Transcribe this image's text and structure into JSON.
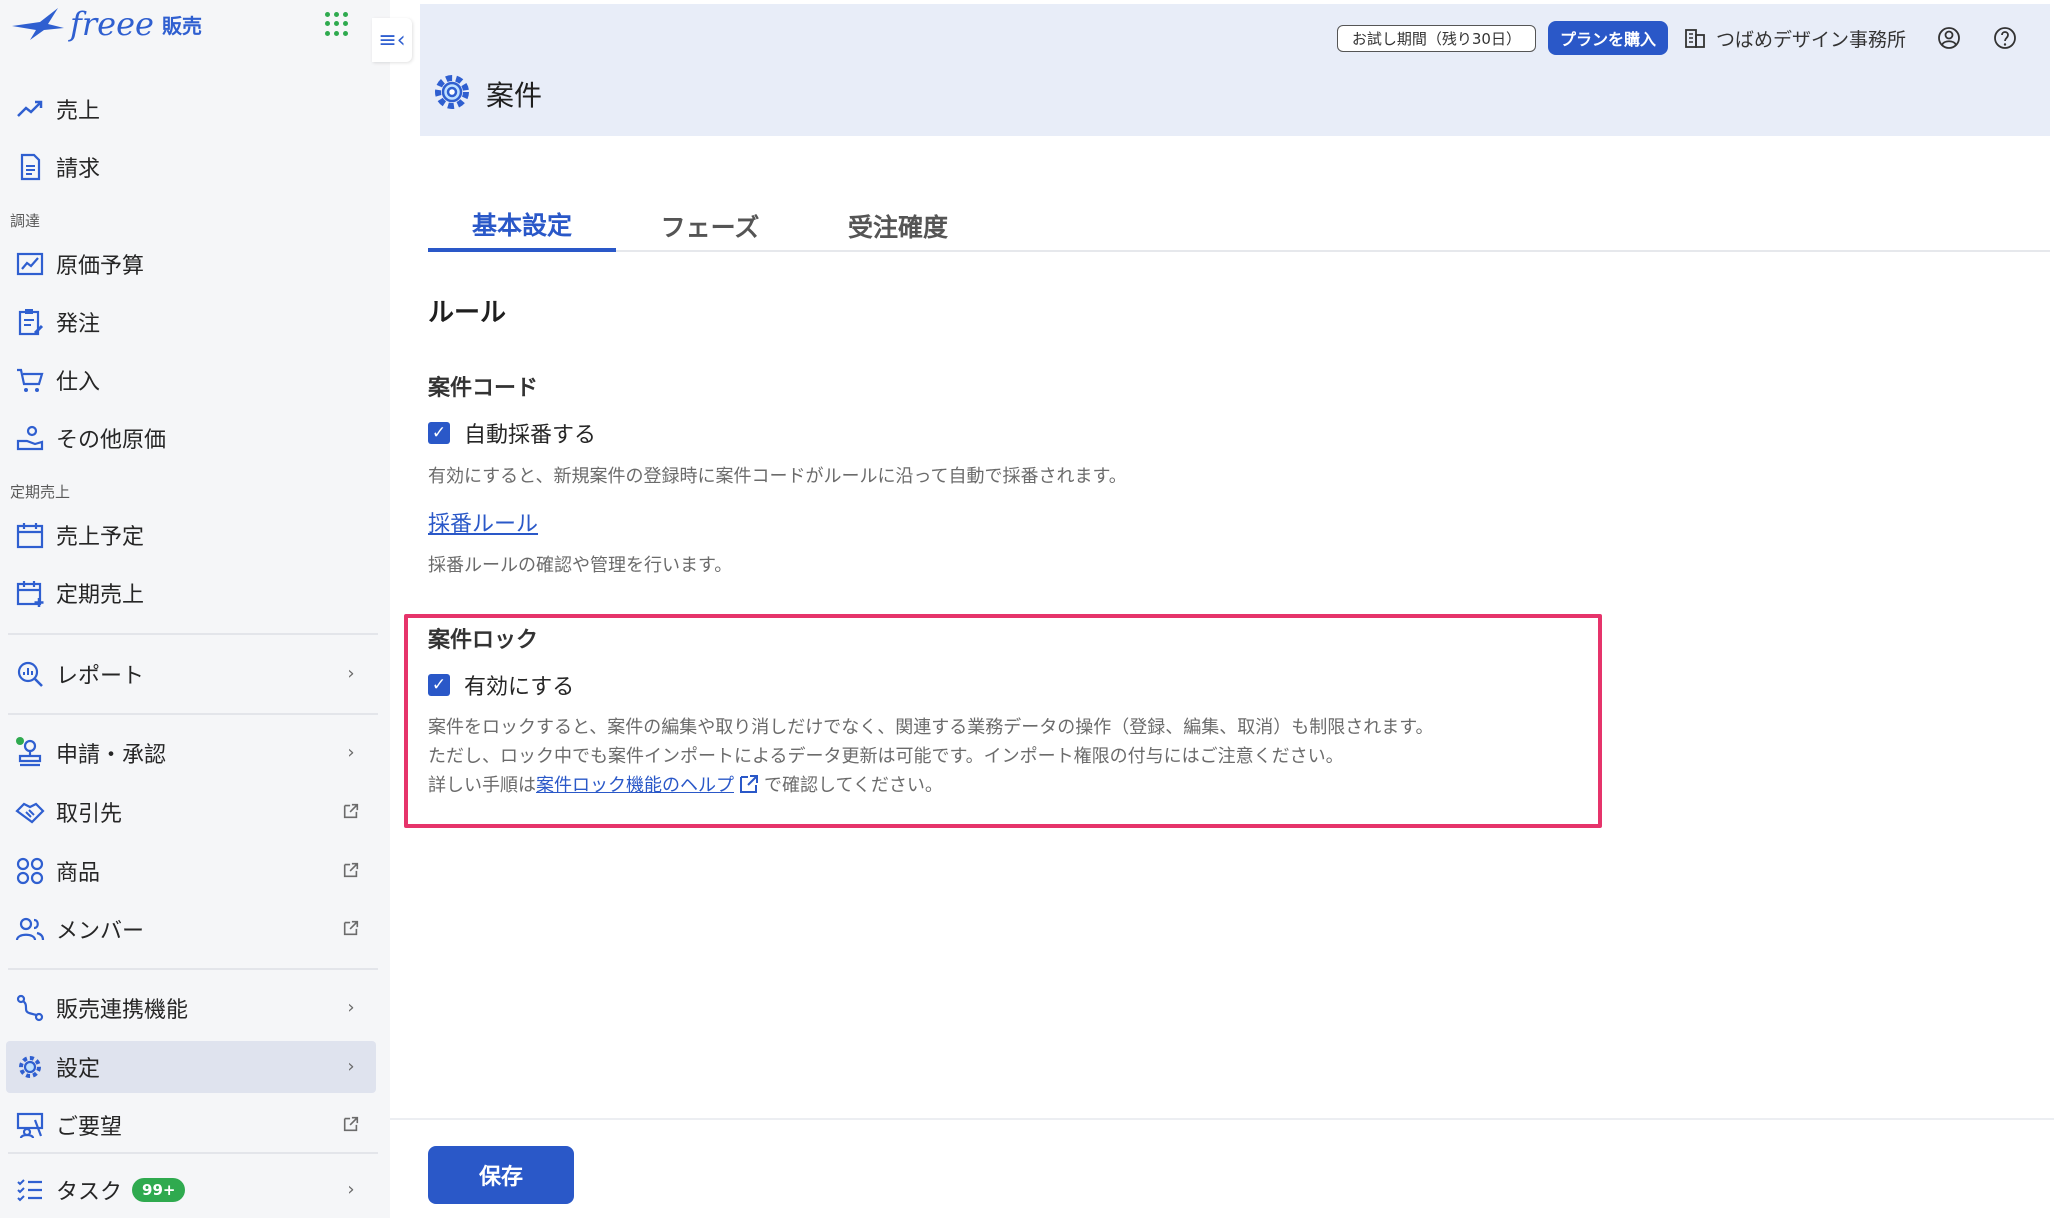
{
  "brand": {
    "logo": "freee",
    "product": "販売"
  },
  "sidebar": {
    "items": [
      {
        "label": "売上",
        "icon": "trend-up-icon"
      },
      {
        "label": "請求",
        "icon": "document-icon"
      },
      {
        "label": "原価予算",
        "icon": "budget-chart-icon"
      },
      {
        "label": "発注",
        "icon": "clipboard-edit-icon"
      },
      {
        "label": "仕入",
        "icon": "cart-icon"
      },
      {
        "label": "その他原価",
        "icon": "hand-coin-icon"
      },
      {
        "label": "売上予定",
        "icon": "calendar-icon"
      },
      {
        "label": "定期売上",
        "icon": "calendar-plus-icon"
      },
      {
        "label": "レポート",
        "icon": "report-search-icon"
      },
      {
        "label": "申請・承認",
        "icon": "stamp-icon"
      },
      {
        "label": "取引先",
        "icon": "handshake-icon"
      },
      {
        "label": "商品",
        "icon": "products-icon"
      },
      {
        "label": "メンバー",
        "icon": "members-icon"
      },
      {
        "label": "販売連携機能",
        "icon": "integration-icon"
      },
      {
        "label": "設定",
        "icon": "gear-icon"
      },
      {
        "label": "ご要望",
        "icon": "feedback-icon"
      },
      {
        "label": "タスク",
        "icon": "task-list-icon",
        "badge": "99+"
      }
    ],
    "sections": {
      "procurement": "調達",
      "recurring": "定期売上"
    }
  },
  "header": {
    "trial": "お試し期間（残り30日）",
    "buy": "プランを購入",
    "org": "つばめデザイン事務所"
  },
  "page": {
    "title": "案件"
  },
  "tabs": [
    {
      "label": "基本設定"
    },
    {
      "label": "フェーズ"
    },
    {
      "label": "受注確度"
    }
  ],
  "content": {
    "rule_heading": "ルール",
    "code": {
      "heading": "案件コード",
      "checkbox_label": "自動採番する",
      "description": "有効にすると、新規案件の登録時に案件コードがルールに沿って自動で採番されます。",
      "link": "採番ルール",
      "link_description": "採番ルールの確認や管理を行います。"
    },
    "lock": {
      "heading": "案件ロック",
      "checkbox_label": "有効にする",
      "line1": "案件をロックすると、案件の編集や取り消しだけでなく、関連する業務データの操作（登録、編集、取消）も制限されます。",
      "line2": "ただし、ロック中でも案件インポートによるデータ更新は可能です。インポート権限の付与にはご注意ください。",
      "line3_prefix": "詳しい手順は",
      "line3_link": "案件ロック機能のヘルプ",
      "line3_suffix": "で確認してください。"
    }
  },
  "footer": {
    "save": "保存"
  },
  "colors": {
    "accent": "#2a58c8",
    "highlight": "#e6346b",
    "badge": "#2faa4f",
    "header_bg": "#e8edf8"
  }
}
